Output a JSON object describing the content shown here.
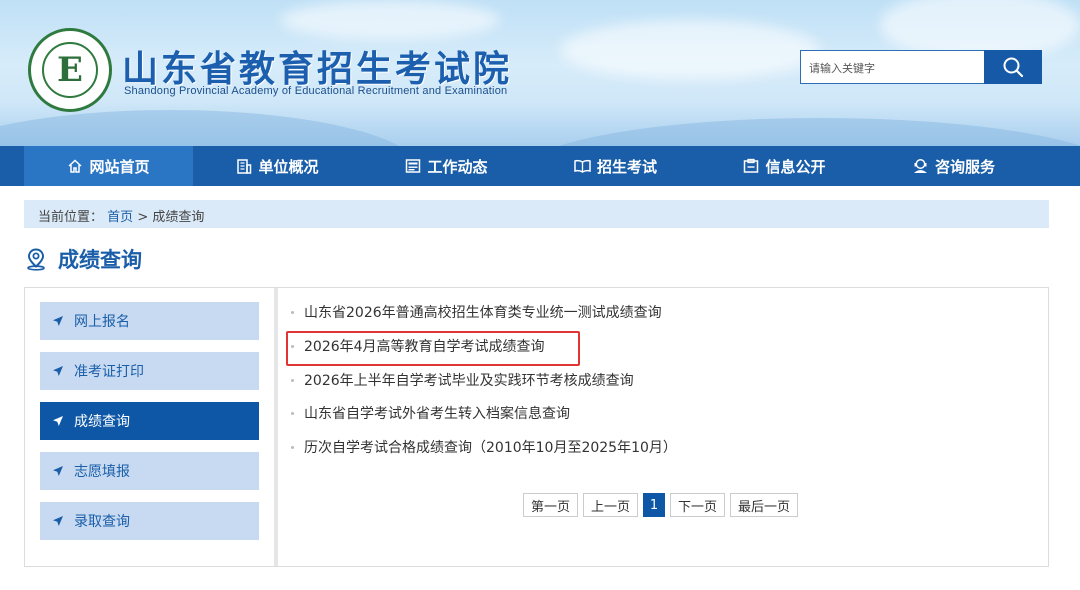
{
  "header": {
    "title": "山东省教育招生考试院",
    "subtitle": "Shandong Provincial Academy of Educational Recruitment and Examination",
    "logo_letter": "E",
    "search": {
      "placeholder": "请输入关键字"
    }
  },
  "nav": {
    "items": [
      {
        "label": "网站首页",
        "icon": "home-icon",
        "active": true
      },
      {
        "label": "单位概况",
        "icon": "building-icon"
      },
      {
        "label": "工作动态",
        "icon": "news-icon"
      },
      {
        "label": "招生考试",
        "icon": "exam-icon"
      },
      {
        "label": "信息公开",
        "icon": "info-icon"
      },
      {
        "label": "咨询服务",
        "icon": "consult-icon"
      }
    ]
  },
  "breadcrumb": {
    "prefix": "当前位置：",
    "home": "首页",
    "separator": ">",
    "current": "成绩查询"
  },
  "page": {
    "title": "成绩查询",
    "icon": "location-pin-icon"
  },
  "sidebar": {
    "items": [
      {
        "label": "网上报名"
      },
      {
        "label": "准考证打印"
      },
      {
        "label": "成绩查询",
        "active": true
      },
      {
        "label": "志愿填报"
      },
      {
        "label": "录取查询"
      }
    ]
  },
  "list": {
    "items": [
      {
        "text": "山东省2026年普通高校招生体育类专业统一测试成绩查询"
      },
      {
        "text": "2026年4月高等教育自学考试成绩查询",
        "highlighted": true
      },
      {
        "text": "2026年上半年自学考试毕业及实践环节考核成绩查询"
      },
      {
        "text": "山东省自学考试外省考生转入档案信息查询"
      },
      {
        "text": "历次自学考试合格成绩查询（2010年10月至2025年10月）"
      }
    ]
  },
  "pagination": {
    "first": "第一页",
    "prev": "上一页",
    "current": "1",
    "next": "下一页",
    "last": "最后一页"
  },
  "colors": {
    "nav_bg": "#1a5ea9",
    "nav_active": "#2b76c4",
    "sidebar_active": "#0e57a7",
    "sidebar_item": "#c7daf1",
    "highlight": "#e13434"
  }
}
